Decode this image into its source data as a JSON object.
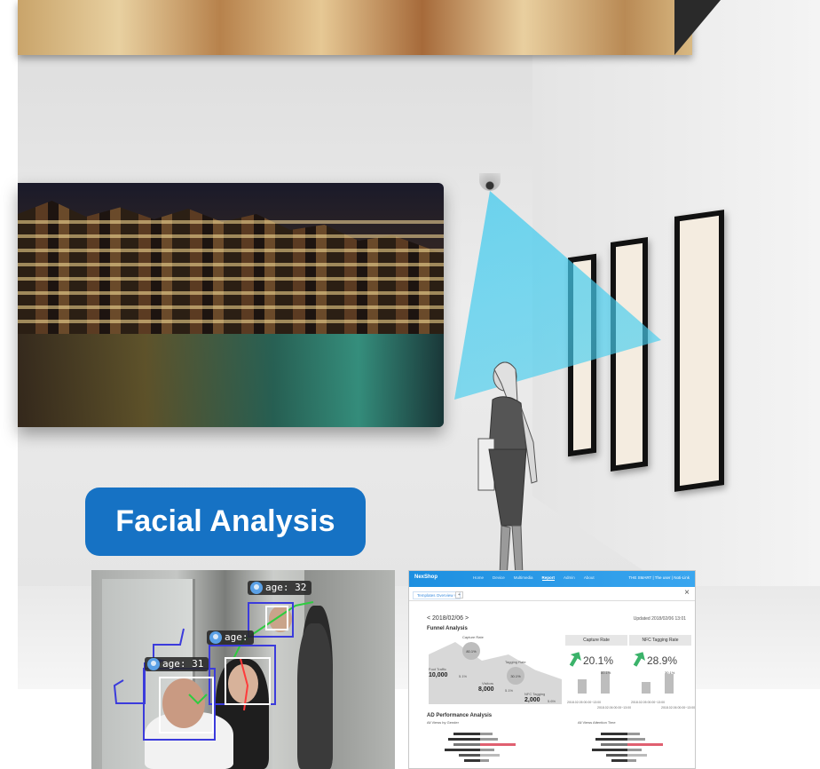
{
  "badge": {
    "label": "Facial Analysis"
  },
  "face_tags": [
    {
      "age_text": "age:  32"
    },
    {
      "age_text": "age:"
    },
    {
      "age_text": "age:  31"
    }
  ],
  "dashboard": {
    "brand": "NexShop",
    "nav": [
      "Home",
      "Device",
      "Multimedia",
      "Report",
      "Admin",
      "About"
    ],
    "active_nav": "Report",
    "user": "THE SMART  |  The user  |  Noti-Link",
    "close_glyph": "×",
    "tab": "Templates  Overview ×",
    "tab_add": "+",
    "date": "< 2018/02/06 >",
    "updated": "Updated 2018/02/06 13:01",
    "funnel_title": "Funnel Analysis",
    "funnel": {
      "capture_rate_label": "Capture Rate",
      "capture_rate_value": "80.1%",
      "tagging_rate_label": "Tagging Rate",
      "tagging_rate_value": "30.1%",
      "foot_traffic_label": "Foot Traffic",
      "foot_traffic_value": "10,000",
      "foot_traffic_pct": "5.1%",
      "visitors_label": "Visitors",
      "visitors_value": "8,000",
      "visitors_pct": "5.1%",
      "nfc_tagging_label": "NFC Tagging",
      "nfc_tagging_value": "2,000",
      "nfc_tagging_pct": "5.6%"
    },
    "kpis": [
      {
        "title": "Capture Rate",
        "value": "20.1%",
        "sub": "80.1%",
        "dates": [
          "2018.02.05 00:00~13:00",
          "2018.02.06 00:00~13:00"
        ],
        "bars": [
          0.45,
          0.7
        ]
      },
      {
        "title": "NFC Tagging Rate",
        "value": "28.9%",
        "sub": "30.1%",
        "dates": [
          "2018.02.05 00:00~13:00",
          "2018.02.06 00:00~13:00"
        ],
        "bars": [
          0.35,
          0.6
        ]
      }
    ],
    "ad_title": "AD Performance Analysis",
    "ad_sub_left": "All Views by Gender",
    "ad_sub_right": "All Views Attention Time"
  },
  "colors": {
    "badge": "#1672c4",
    "cone": "#3cc8f0",
    "dashboard_header": "#1d8fe0",
    "kpi_arrow": "#3bb36a",
    "highlight_bar": "#e06070"
  }
}
